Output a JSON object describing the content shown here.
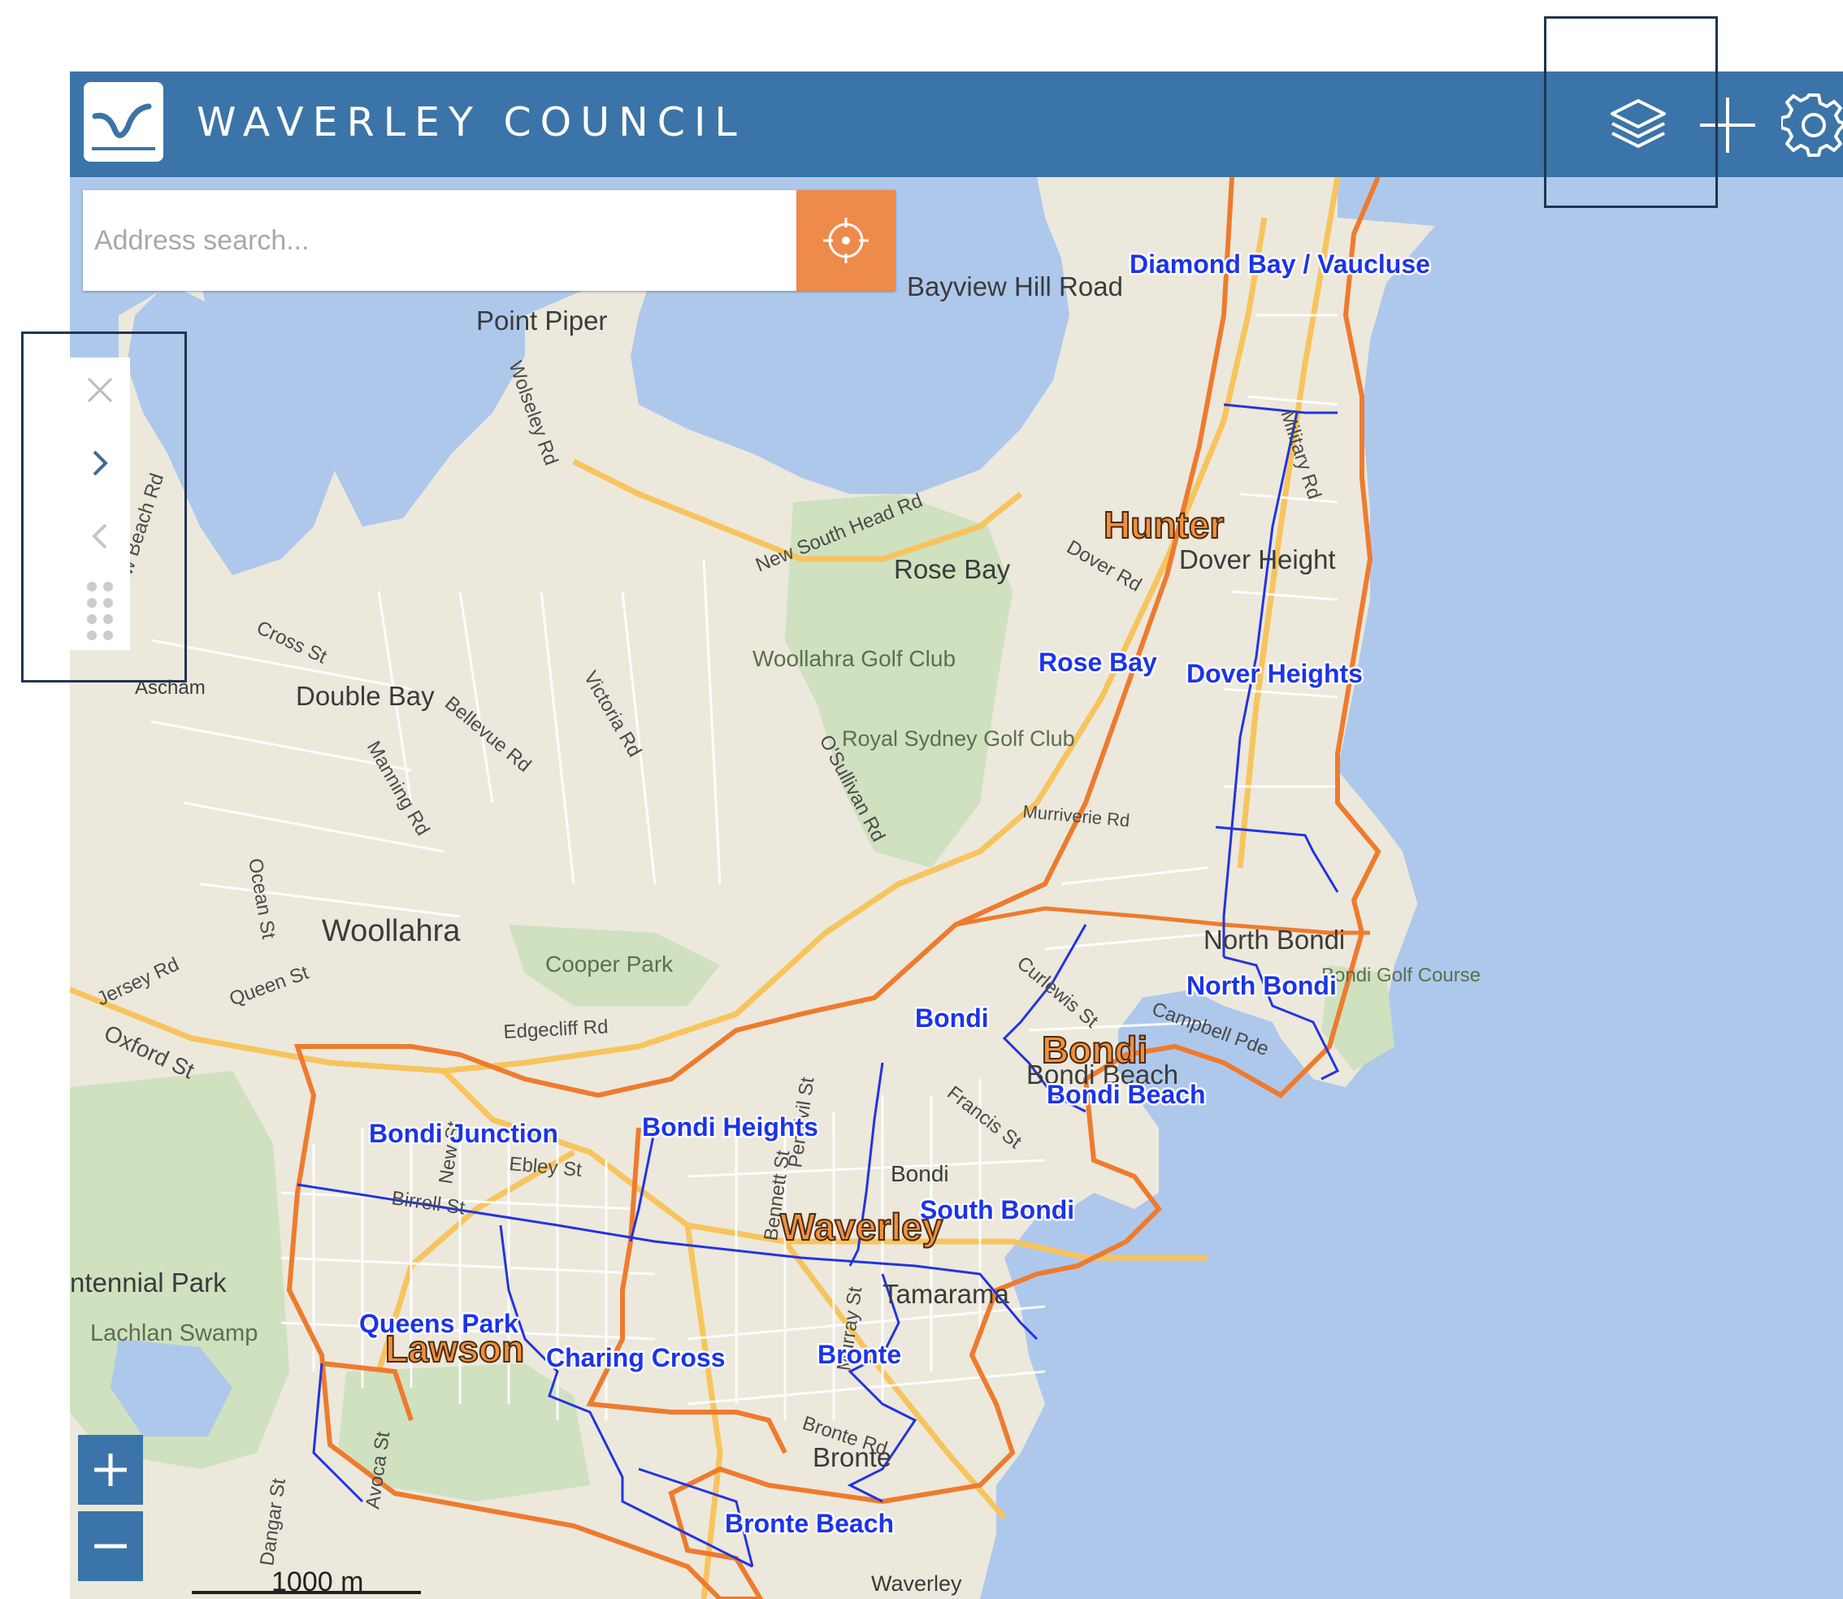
{
  "header": {
    "brand": "WAVERLEY COUNCIL",
    "logo_icon": "waverley-wave-logo",
    "actions": [
      {
        "name": "layers",
        "icon": "layers-icon"
      },
      {
        "name": "add",
        "icon": "plus-icon"
      },
      {
        "name": "settings",
        "icon": "gear-icon"
      }
    ]
  },
  "search": {
    "placeholder": "Address search...",
    "value": "",
    "locate_icon": "crosshair-icon"
  },
  "side_panel": {
    "icons": [
      "close-icon",
      "chevron-right-icon",
      "chevron-left-icon",
      "drag-handle-icon"
    ]
  },
  "zoom": {
    "in_label": "+",
    "out_label": "−"
  },
  "scalebar": {
    "label": "1000 m"
  },
  "map": {
    "colors": {
      "water": "#aec8ec",
      "land": "#ece8dc",
      "park": "#cfe1bf",
      "road_major": "#f7c45d",
      "ward_boundary": "#ee7b2e",
      "suburb_boundary": "#2234e0",
      "suburb_label": "#1c34e8",
      "ward_label": "#f0913f"
    },
    "place_labels": {
      "point_piper": "Point Piper",
      "bayview_hill_road": "Bayview Hill Road",
      "rose_bay_place": "Rose Bay",
      "woollahra_golf_club": "Woollahra Golf Club",
      "royal_sydney_golf_club": "Royal Sydney Golf Club",
      "double_bay": "Double Bay",
      "woollahra": "Woollahra",
      "cooper_park": "Cooper Park",
      "centennial_park": "ntennial Park",
      "lachlan_swamp": "Lachlan Swamp",
      "dover_heights_place": "Dover Height",
      "north_bondi_place": "North Bondi",
      "bondi_golf_course": "Bondi Golf Course",
      "bondi_beach_place": "Bondi Beach",
      "tamarama": "Tamarama",
      "bronte_place": "Bronte",
      "waverley_place": "Waverley",
      "ascham": "Ascham",
      "bondi_road": "Bondi"
    },
    "street_labels": {
      "new_south_head_rd": "New South Head Rd",
      "wolseley_rd": "Wolseley Rd",
      "cross_st": "Cross St",
      "bellevue_rd": "Bellevue Rd",
      "manning_rd": "Manning Rd",
      "victoria_rd": "Victoria Rd",
      "osullivan_rd": "O'Sullivan Rd",
      "ocean_st": "Ocean St",
      "jersey_rd": "Jersey Rd",
      "queen_st": "Queen St",
      "oxford_st": "Oxford St",
      "edgecliff_rd": "Edgecliff Rd",
      "dover_rd": "Dover Rd",
      "military_rd": "Military Rd",
      "murriverie_rd": "Murriverie Rd",
      "curlewis_st": "Curlewis St",
      "campbell_pde": "Campbell Pde",
      "francis_st": "Francis St",
      "birrell_st": "Birrell St",
      "ebley_st": "Ebley St",
      "bronte_rd": "Bronte Rd",
      "avoca_st": "Avoca St",
      "dangar_st": "Dangar St",
      "new_beach_rd": "New Beach Rd",
      "penkivil_st": "Penkivil St",
      "bennett_st": "Bennett St",
      "murray_st": "Murray St",
      "new_st": "New St"
    },
    "suburb_labels": {
      "diamond_bay": "Diamond Bay / Vaucluse",
      "rose_bay": "Rose Bay",
      "dover_heights": "Dover Heights",
      "north_bondi": "North Bondi",
      "bondi": "Bondi",
      "bondi_beach": "Bondi Beach",
      "bondi_junction": "Bondi Junction",
      "bondi_heights": "Bondi Heights",
      "south_bondi": "South Bondi",
      "queens_park": "Queens Park",
      "charing_cross": "Charing Cross",
      "bronte": "Bronte",
      "bronte_beach": "Bronte Beach"
    },
    "ward_labels": {
      "hunter": "Hunter",
      "bondi": "Bondi",
      "waverley": "Waverley",
      "lawson": "Lawson"
    }
  }
}
